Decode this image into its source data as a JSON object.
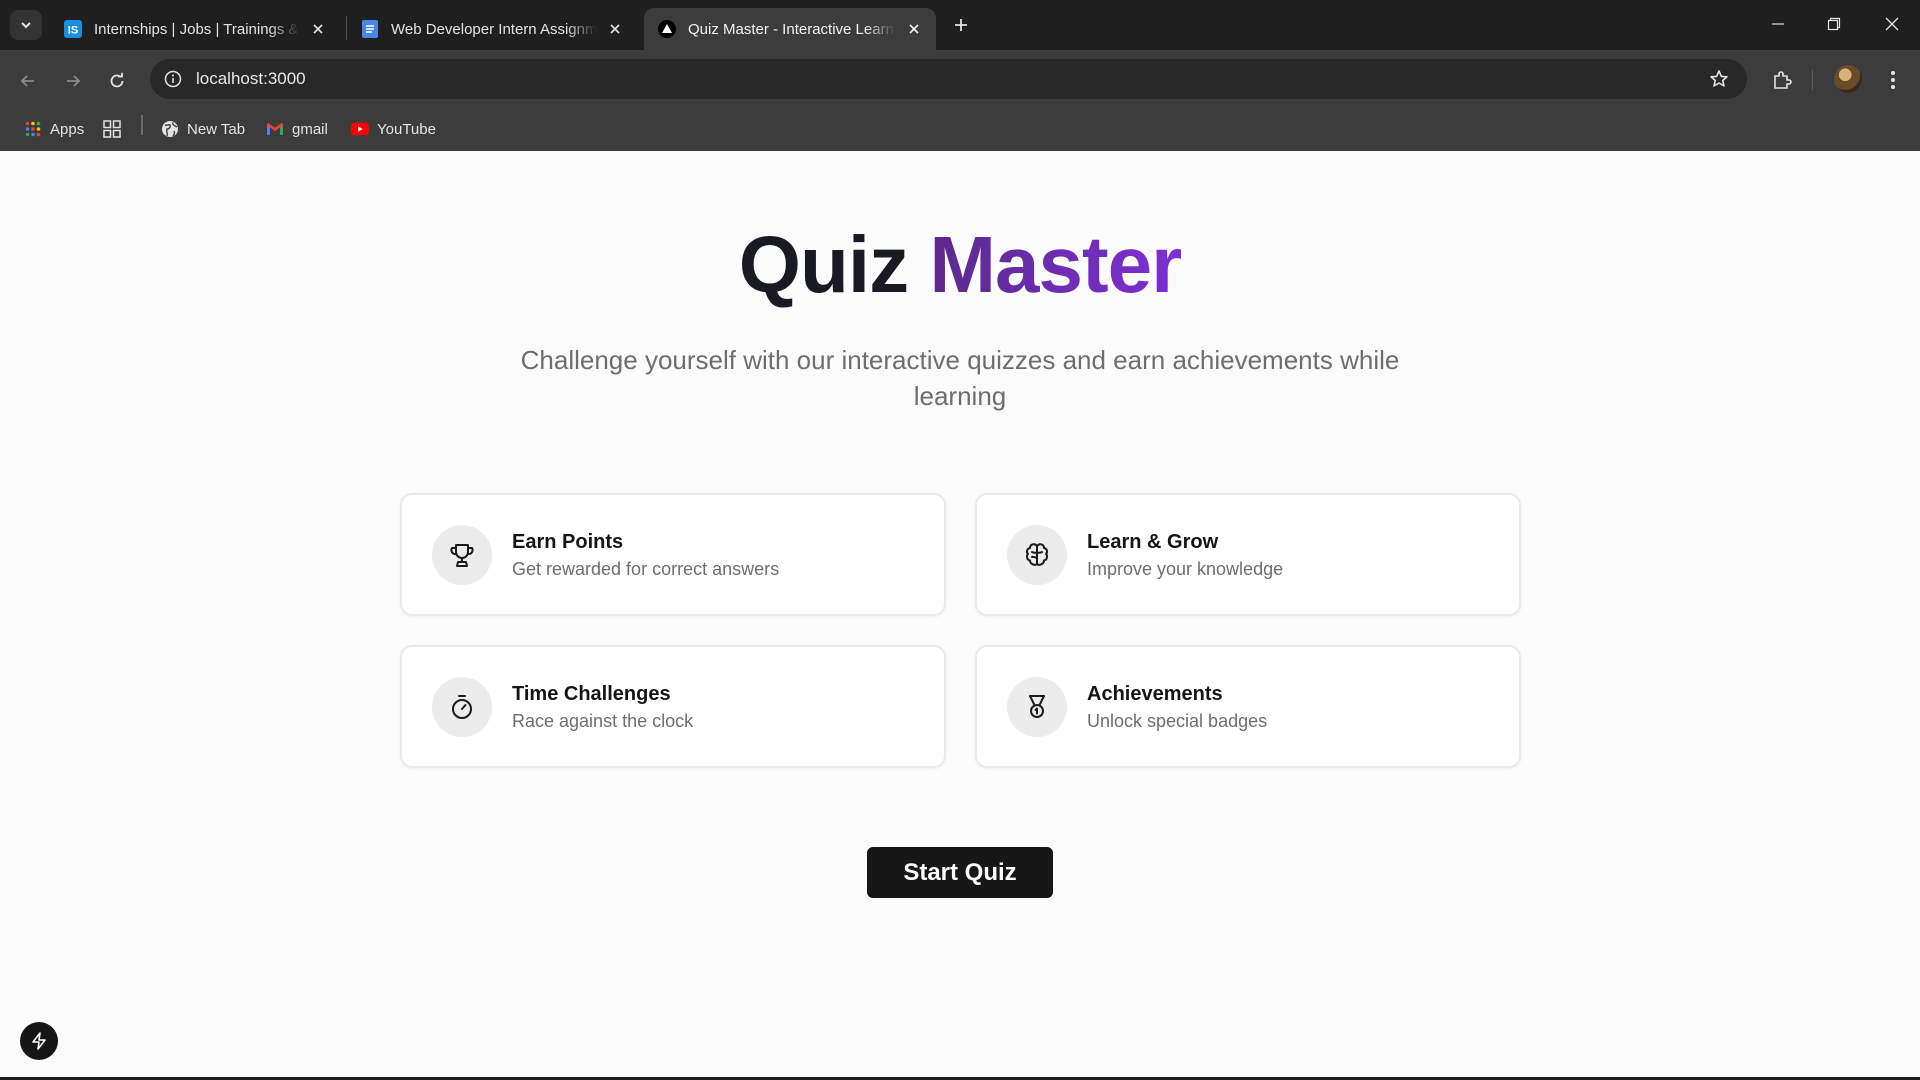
{
  "browser": {
    "tabs": [
      {
        "title": "Internships | Jobs | Trainings & Projects",
        "icon": "internshala-favicon",
        "active": false
      },
      {
        "title": "Web Developer Intern Assignment",
        "icon": "google-docs-favicon",
        "active": false
      },
      {
        "title": "Quiz Master - Interactive Learning",
        "icon": "nextjs-favicon",
        "active": true
      }
    ],
    "url": "localhost:3000",
    "bookmarks": [
      {
        "label": "Apps",
        "icon": "apps-grid-icon"
      },
      {
        "label": "",
        "icon": "tab-groups-icon"
      },
      {
        "label": "New Tab",
        "icon": "globe-icon"
      },
      {
        "label": "gmail",
        "icon": "gmail-icon"
      },
      {
        "label": "YouTube",
        "icon": "youtube-icon"
      }
    ],
    "colors": {
      "tabstrip": "#1f1f1f",
      "toolbar": "#3c3c3c",
      "omnibox": "#282828"
    }
  },
  "hero": {
    "title_part1": "Quiz",
    "title_part2": "Master",
    "subtitle": "Challenge yourself with our interactive quizzes and earn achievements while learning"
  },
  "features": [
    {
      "title": "Earn Points",
      "description": "Get rewarded for correct answers",
      "icon": "trophy-icon"
    },
    {
      "title": "Learn & Grow",
      "description": "Improve your knowledge",
      "icon": "brain-icon"
    },
    {
      "title": "Time Challenges",
      "description": "Race against the clock",
      "icon": "timer-icon"
    },
    {
      "title": "Achievements",
      "description": "Unlock special badges",
      "icon": "medal-icon"
    }
  ],
  "cta": {
    "label": "Start Quiz"
  },
  "colors": {
    "accent_start": "#5b2a8c",
    "accent_end": "#7e2fd3",
    "button": "#171717",
    "page_bg": "#fbfbfb"
  }
}
